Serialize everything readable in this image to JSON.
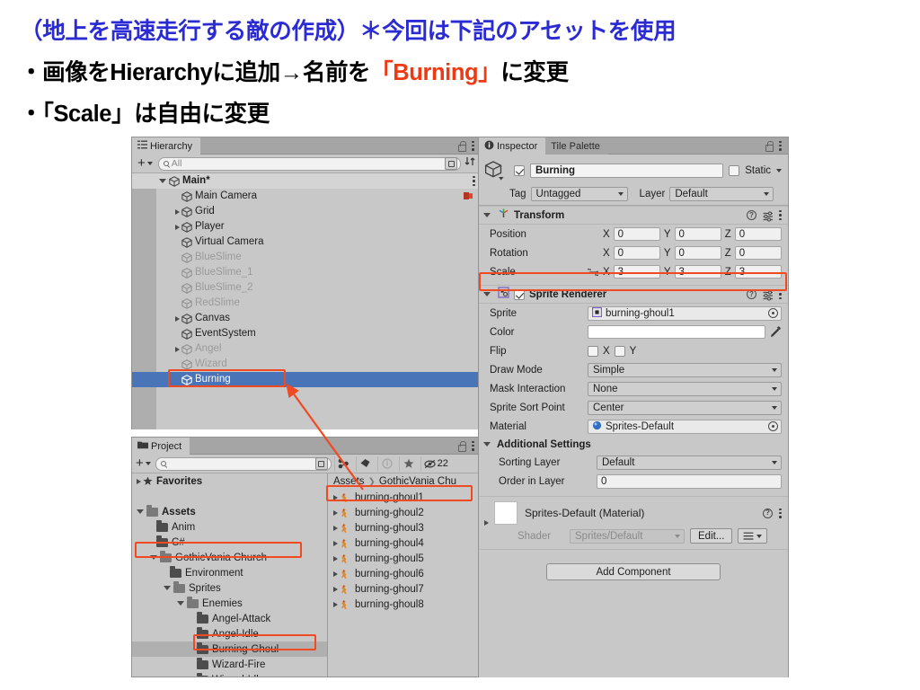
{
  "slide": {
    "title_blue": "（地上を高速走行する敵の作成）＊今回は下記のアセットを使用",
    "bullet1_pre": "・画像をHierarchyに追加→名前を",
    "bullet1_red": "「Burning」",
    "bullet1_post": "に変更",
    "bullet2": "・「Scale」は自由に変更",
    "accent_red": "#ee3a14",
    "accent_blue": "#2b2bd4"
  },
  "hierarchy": {
    "tab_label": "Hierarchy",
    "search_placeholder": "All",
    "items": [
      {
        "label": "Main*",
        "indent": 0,
        "arrow": "open",
        "state": "root"
      },
      {
        "label": "Main Camera",
        "indent": 1,
        "arrow": "none",
        "state": "normal",
        "badge": "prefab-icon"
      },
      {
        "label": "Grid",
        "indent": 1,
        "arrow": "closed",
        "state": "normal"
      },
      {
        "label": "Player",
        "indent": 1,
        "arrow": "closed",
        "state": "normal"
      },
      {
        "label": "Virtual Camera",
        "indent": 1,
        "arrow": "none",
        "state": "normal"
      },
      {
        "label": "BlueSlime",
        "indent": 1,
        "arrow": "none",
        "state": "dim"
      },
      {
        "label": "BlueSlime_1",
        "indent": 1,
        "arrow": "none",
        "state": "dim"
      },
      {
        "label": "BlueSlime_2",
        "indent": 1,
        "arrow": "none",
        "state": "dim"
      },
      {
        "label": "RedSlime",
        "indent": 1,
        "arrow": "none",
        "state": "dim"
      },
      {
        "label": "Canvas",
        "indent": 1,
        "arrow": "closed",
        "state": "normal"
      },
      {
        "label": "EventSystem",
        "indent": 1,
        "arrow": "none",
        "state": "normal"
      },
      {
        "label": "Angel",
        "indent": 1,
        "arrow": "closed",
        "state": "dim"
      },
      {
        "label": "Wizard",
        "indent": 1,
        "arrow": "none",
        "state": "dim"
      },
      {
        "label": "Burning",
        "indent": 1,
        "arrow": "none",
        "state": "selected"
      }
    ]
  },
  "project": {
    "tab_label": "Project",
    "search_placeholder": "",
    "hidden_count": "22",
    "breadcrumb": [
      "Assets",
      "GothicVania Chu"
    ],
    "tree": [
      {
        "label": "Favorites",
        "indent": 0,
        "arrow": "closed",
        "icon": "star",
        "bold": true
      },
      {
        "label": "",
        "indent": 0,
        "arrow": "none",
        "icon": "none",
        "spacer": true
      },
      {
        "label": "Assets",
        "indent": 0,
        "arrow": "open",
        "icon": "folder-open",
        "bold": true
      },
      {
        "label": "Anim",
        "indent": 1,
        "arrow": "none",
        "icon": "folder"
      },
      {
        "label": "C#",
        "indent": 1,
        "arrow": "none",
        "icon": "folder"
      },
      {
        "label": "GothicVania Church",
        "indent": 1,
        "arrow": "open",
        "icon": "folder-open"
      },
      {
        "label": "Environment",
        "indent": 2,
        "arrow": "none",
        "icon": "folder"
      },
      {
        "label": "Sprites",
        "indent": 2,
        "arrow": "open",
        "icon": "folder-open"
      },
      {
        "label": "Enemies",
        "indent": 3,
        "arrow": "open",
        "icon": "folder-open"
      },
      {
        "label": "Angel-Attack",
        "indent": 4,
        "arrow": "none",
        "icon": "folder"
      },
      {
        "label": "Angel-Idle",
        "indent": 4,
        "arrow": "none",
        "icon": "folder"
      },
      {
        "label": "Burning-Ghoul",
        "indent": 4,
        "arrow": "none",
        "icon": "folder",
        "selected": true
      },
      {
        "label": "Wizard-Fire",
        "indent": 4,
        "arrow": "none",
        "icon": "folder"
      },
      {
        "label": "Wizard-Idle",
        "indent": 4,
        "arrow": "none",
        "icon": "folder"
      }
    ],
    "assets": [
      {
        "label": "burning-ghoul1"
      },
      {
        "label": "burning-ghoul2"
      },
      {
        "label": "burning-ghoul3"
      },
      {
        "label": "burning-ghoul4"
      },
      {
        "label": "burning-ghoul5"
      },
      {
        "label": "burning-ghoul6"
      },
      {
        "label": "burning-ghoul7"
      },
      {
        "label": "burning-ghoul8"
      }
    ]
  },
  "inspector": {
    "tab_label": "Inspector",
    "tab2_label": "Tile Palette",
    "object_name": "Burning",
    "static_label": "Static",
    "tag_label": "Tag",
    "tag_value": "Untagged",
    "layer_label": "Layer",
    "layer_value": "Default",
    "transform": {
      "title": "Transform",
      "rows": [
        {
          "label": "Position",
          "x": "0",
          "y": "0",
          "z": "0",
          "linked": false
        },
        {
          "label": "Rotation",
          "x": "0",
          "y": "0",
          "z": "0",
          "linked": false
        },
        {
          "label": "Scale",
          "x": "3",
          "y": "3",
          "z": "3",
          "linked": true
        }
      ],
      "axis_x": "X",
      "axis_y": "Y",
      "axis_z": "Z"
    },
    "sprite_renderer": {
      "title": "Sprite Renderer",
      "sprite_label": "Sprite",
      "sprite_value": "burning-ghoul1",
      "color_label": "Color",
      "flip_label": "Flip",
      "flip_x": "X",
      "flip_y": "Y",
      "draw_mode_label": "Draw Mode",
      "draw_mode_value": "Simple",
      "mask_label": "Mask Interaction",
      "mask_value": "None",
      "sort_point_label": "Sprite Sort Point",
      "sort_point_value": "Center",
      "material_label": "Material",
      "material_value": "Sprites-Default"
    },
    "additional_settings": {
      "title": "Additional Settings",
      "sorting_layer_label": "Sorting Layer",
      "sorting_layer_value": "Default",
      "order_label": "Order in Layer",
      "order_value": "0"
    },
    "material_block": {
      "title": "Sprites-Default (Material)",
      "shader_label": "Shader",
      "shader_value": "Sprites/Default",
      "edit_label": "Edit..."
    },
    "add_component_label": "Add Component"
  }
}
